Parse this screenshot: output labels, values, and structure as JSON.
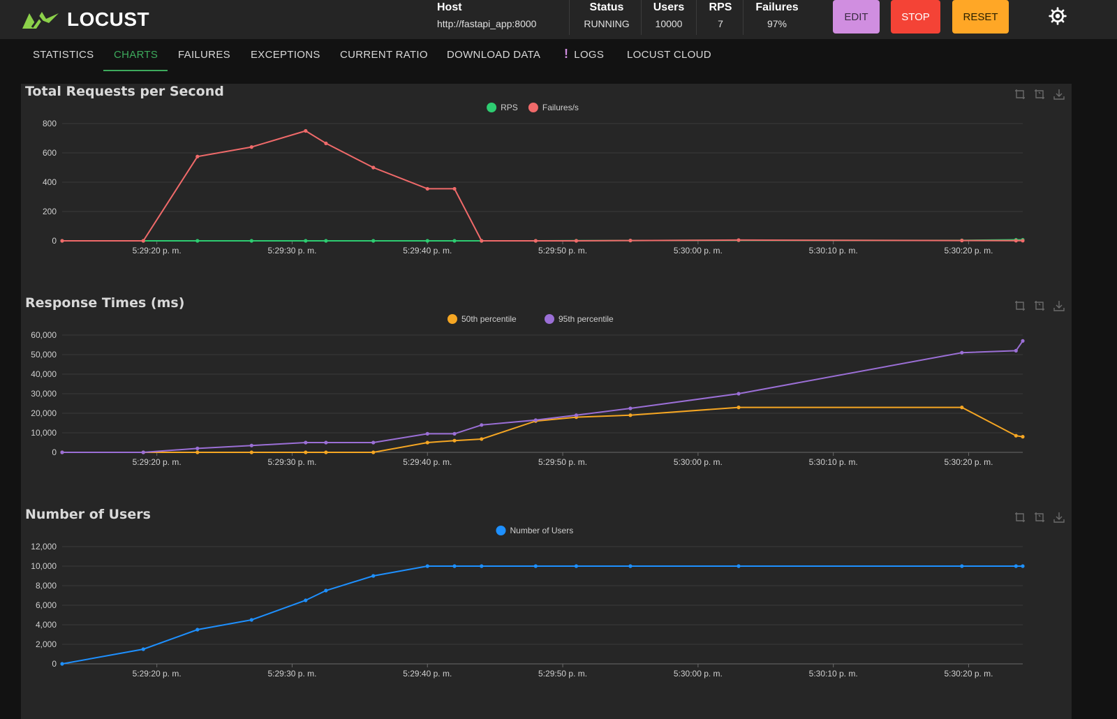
{
  "app": {
    "name": "LOCUST"
  },
  "stats": {
    "host": {
      "label": "Host",
      "value": "http://fastapi_app:8000"
    },
    "status": {
      "label": "Status",
      "value": "RUNNING"
    },
    "users": {
      "label": "Users",
      "value": "10000"
    },
    "rps": {
      "label": "RPS",
      "value": "7"
    },
    "failures": {
      "label": "Failures",
      "value": "97%"
    }
  },
  "buttons": {
    "edit": "EDIT",
    "stop": "STOP",
    "reset": "RESET"
  },
  "tabs": [
    {
      "label": "STATISTICS"
    },
    {
      "label": "CHARTS",
      "active": true
    },
    {
      "label": "FAILURES"
    },
    {
      "label": "EXCEPTIONS"
    },
    {
      "label": "CURRENT RATIO"
    },
    {
      "label": "DOWNLOAD DATA"
    },
    {
      "label": "LOGS",
      "warning": "!"
    },
    {
      "label": "LOCUST CLOUD"
    }
  ],
  "colors": {
    "rps": "#2ecc71",
    "failures": "#f06a6a",
    "p50": "#f5a623",
    "p95": "#9b6fd6",
    "users": "#1e90ff",
    "accent": "#3daa5c"
  },
  "chart_data": [
    {
      "type": "line",
      "title": "Total Requests per Second",
      "x_ticks": [
        "5:29:20 p. m.",
        "5:29:30 p. m.",
        "5:29:40 p. m.",
        "5:29:50 p. m.",
        "5:30:00 p. m.",
        "5:30:10 p. m.",
        "5:30:20 p. m."
      ],
      "y_ticks": [
        "0",
        "200",
        "400",
        "600",
        "800"
      ],
      "ylim": [
        0,
        800
      ],
      "x": [
        "5:29:13",
        "5:29:19",
        "5:29:23",
        "5:29:27",
        "5:29:31",
        "5:29:32.5",
        "5:29:36",
        "5:29:40",
        "5:29:42",
        "5:29:44",
        "5:29:48",
        "5:29:51",
        "5:29:55",
        "5:30:03",
        "5:30:19.5",
        "5:30:23.5",
        "5:30:24"
      ],
      "series": [
        {
          "name": "RPS",
          "color": "#2ecc71",
          "values": [
            0,
            0,
            0,
            0,
            0,
            0,
            0,
            0,
            0,
            0,
            0,
            1,
            2,
            4,
            3,
            7,
            7
          ]
        },
        {
          "name": "Failures/s",
          "color": "#f06a6a",
          "values": [
            0,
            0,
            575,
            640,
            750,
            665,
            500,
            355,
            355,
            0,
            0,
            0,
            2,
            5,
            2,
            1,
            1
          ]
        }
      ],
      "legend": "top-center",
      "grid": true
    },
    {
      "type": "line",
      "title": "Response Times (ms)",
      "x_ticks": [
        "5:29:20 p. m.",
        "5:29:30 p. m.",
        "5:29:40 p. m.",
        "5:29:50 p. m.",
        "5:30:00 p. m.",
        "5:30:10 p. m.",
        "5:30:20 p. m."
      ],
      "y_ticks": [
        "0",
        "10,000",
        "20,000",
        "30,000",
        "40,000",
        "50,000",
        "60,000"
      ],
      "ylim": [
        0,
        60000
      ],
      "x": [
        "5:29:13",
        "5:29:19",
        "5:29:23",
        "5:29:27",
        "5:29:31",
        "5:29:32.5",
        "5:29:36",
        "5:29:40",
        "5:29:42",
        "5:29:44",
        "5:29:48",
        "5:29:51",
        "5:29:55",
        "5:30:03",
        "5:30:19.5",
        "5:30:23.5",
        "5:30:24"
      ],
      "series": [
        {
          "name": "50th percentile",
          "color": "#f5a623",
          "values": [
            0,
            0,
            0,
            0,
            0,
            0,
            0,
            5000,
            6000,
            6800,
            16000,
            18000,
            19000,
            23000,
            23000,
            8500,
            8000
          ]
        },
        {
          "name": "95th percentile",
          "color": "#9b6fd6",
          "values": [
            0,
            0,
            2000,
            3500,
            5000,
            5000,
            5000,
            9500,
            9500,
            14000,
            16500,
            19000,
            22500,
            30000,
            51000,
            52000,
            57000
          ]
        }
      ],
      "legend": "top-center",
      "grid": true
    },
    {
      "type": "line",
      "title": "Number of Users",
      "x_ticks": [
        "5:29:20 p. m.",
        "5:29:30 p. m.",
        "5:29:40 p. m.",
        "5:29:50 p. m.",
        "5:30:00 p. m.",
        "5:30:10 p. m.",
        "5:30:20 p. m."
      ],
      "y_ticks": [
        "0",
        "2,000",
        "4,000",
        "6,000",
        "8,000",
        "10,000",
        "12,000"
      ],
      "ylim": [
        0,
        12000
      ],
      "x": [
        "5:29:13",
        "5:29:19",
        "5:29:23",
        "5:29:27",
        "5:29:31",
        "5:29:32.5",
        "5:29:36",
        "5:29:40",
        "5:29:42",
        "5:29:44",
        "5:29:48",
        "5:29:51",
        "5:29:55",
        "5:30:03",
        "5:30:19.5",
        "5:30:23.5",
        "5:30:24"
      ],
      "series": [
        {
          "name": "Number of Users",
          "color": "#1e90ff",
          "values": [
            0,
            1500,
            3500,
            4500,
            6500,
            7500,
            9000,
            10000,
            10000,
            10000,
            10000,
            10000,
            10000,
            10000,
            10000,
            10000,
            10000
          ]
        }
      ],
      "legend": "top-center",
      "grid": true
    }
  ]
}
